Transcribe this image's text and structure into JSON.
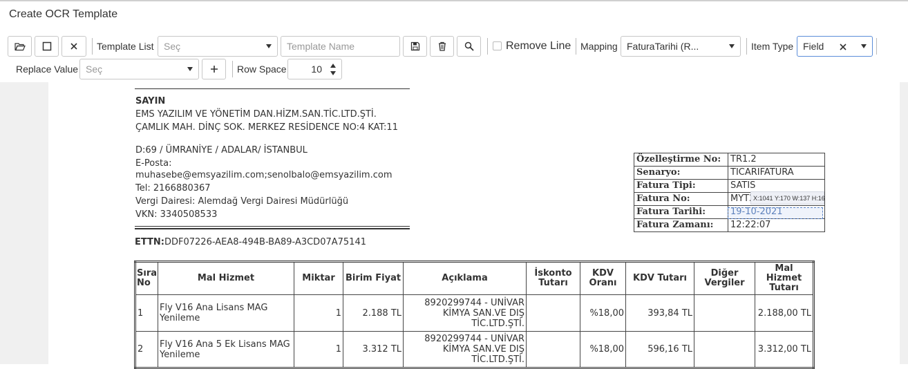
{
  "window": {
    "title": "Create OCR Template"
  },
  "toolbar": {
    "template_list_label": "Template List",
    "template_list_placeholder": "Seç",
    "template_name_placeholder": "Template Name",
    "remove_line_label": "Remove Line",
    "mapping_label": "Mapping",
    "mapping_value": "FaturaTarihi (R...",
    "item_type_label": "Item Type",
    "item_type_value": "Field",
    "replace_value_label": "Replace Value",
    "replace_value_placeholder": "Seç",
    "row_space_label": "Row Space",
    "row_space_value": "10"
  },
  "icons": [
    "folder-open-icon",
    "select-rect-icon",
    "close-icon",
    "save-icon",
    "trash-icon",
    "search-icon",
    "plus-icon",
    "clear-icon",
    "chevron-down-icon"
  ],
  "colors": {
    "selection": "#5a84c7",
    "accent_border": "#5b8dd9"
  },
  "document": {
    "recipient_heading": "SAYIN",
    "company": "EMS YAZILIM VE YÖNETİM DAN.HİZM.SAN.TİC.LTD.ŞTİ.",
    "address1": "ÇAMLIK MAH. DİNÇ SOK. MERKEZ RESİDENCE NO:4 KAT:11",
    "address2": "D:69 / ÜMRANİYE / ADALAR/ İSTANBUL",
    "email_label": "E-Posta:",
    "email": "muhasebe@emsyazilim.com;senolbalo@emsyazilim.com",
    "tel": "Tel: 2166880367",
    "tax_office": "Vergi Dairesi: Alemdağ Vergi Dairesi Müdürlüğü",
    "vkn": "VKN: 3340508533",
    "ettn_label": "ETTN:",
    "ettn": "DDF07226-AEA8-494B-BA89-A3CD07A75141",
    "info": [
      {
        "key": "Özelleştirme No:",
        "value": "TR1.2"
      },
      {
        "key": "Senaryo:",
        "value": "TICARIFATURA"
      },
      {
        "key": "Fatura Tipi:",
        "value": "SATIS"
      },
      {
        "key": "Fatura No:",
        "value": "MYT2"
      },
      {
        "key": "Fatura Tarihi:",
        "value": "19-10-2021"
      },
      {
        "key": "Fatura Zamanı:",
        "value": "12:22:07"
      }
    ],
    "selection_tooltip": "X:1041 Y:170 W:137 H:16",
    "items_headers": [
      "Sıra No",
      "Mal Hizmet",
      "Miktar",
      "Birim Fiyat",
      "Açıklama",
      "İskonto Tutarı",
      "KDV Oranı",
      "KDV Tutarı",
      "Diğer Vergiler",
      "Mal Hizmet Tutarı"
    ],
    "items_rows": [
      [
        "1",
        "Fly V16 Ana Lisans MAG Yenileme",
        "1",
        "2.188 TL",
        "8920299744 - UNİVAR KİMYA SAN.VE DIŞ TİC.LTD.ŞTİ.",
        "",
        "%18,00",
        "393,84 TL",
        "",
        "2.188,00 TL"
      ],
      [
        "2",
        "Fly V16 Ana 5 Ek Lisans MAG Yenileme",
        "1",
        "3.312 TL",
        "8920299744 - UNİVAR KİMYA SAN.VE DIŞ TİC.LTD.ŞTİ.",
        "",
        "%18,00",
        "596,16 TL",
        "",
        "3.312,00 TL"
      ]
    ]
  }
}
